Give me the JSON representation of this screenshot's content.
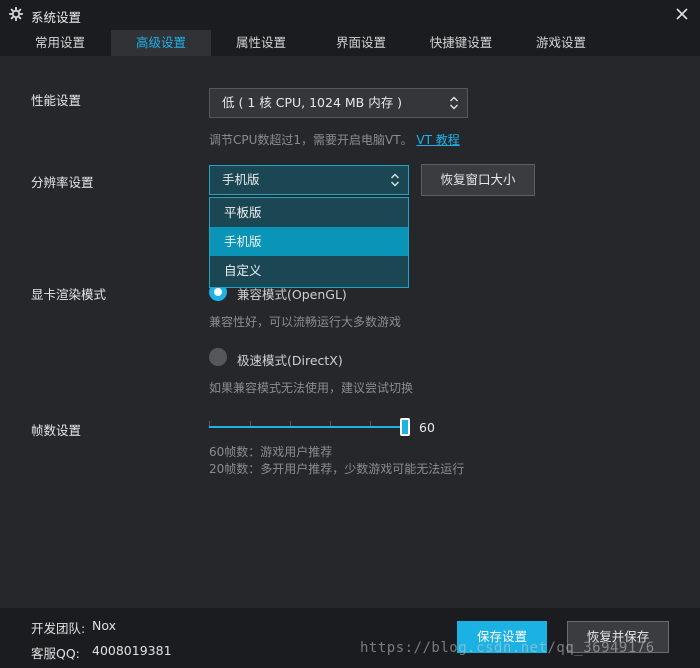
{
  "window": {
    "title": "系统设置"
  },
  "tabs": [
    {
      "label": "常用设置",
      "active": false
    },
    {
      "label": "高级设置",
      "active": true
    },
    {
      "label": "属性设置",
      "active": false
    },
    {
      "label": "界面设置",
      "active": false
    },
    {
      "label": "快捷键设置",
      "active": false
    },
    {
      "label": "游戏设置",
      "active": false
    }
  ],
  "performance": {
    "label": "性能设置",
    "selected": "低 ( 1 核 CPU, 1024 MB 内存 )",
    "hint": "调节CPU数超过1，需要开启电脑VT。",
    "link": "VT 教程"
  },
  "resolution": {
    "label": "分辨率设置",
    "selected": "手机版",
    "restore_button": "恢复窗口大小",
    "options": [
      {
        "label": "平板版",
        "selected": false
      },
      {
        "label": "手机版",
        "selected": true
      },
      {
        "label": "自定义",
        "selected": false
      }
    ]
  },
  "render": {
    "label": "显卡渲染模式",
    "options": [
      {
        "label": "兼容模式(OpenGL)",
        "hint": "兼容性好，可以流畅运行大多数游戏",
        "checked": true
      },
      {
        "label": "极速模式(DirectX)",
        "hint": "如果兼容模式无法使用，建议尝试切换",
        "checked": false
      }
    ]
  },
  "fps": {
    "label": "帧数设置",
    "value": 60,
    "value_text": "60",
    "min": 0,
    "max": 60,
    "hint1": "60帧数：游戏用户推荐",
    "hint2": "20帧数：多开用户推荐，少数游戏可能无法运行"
  },
  "footer": {
    "team_label": "开发团队:",
    "team_value": "Nox",
    "qq_label": "客服QQ:",
    "qq_value": "4008019381",
    "save_button": "保存设置",
    "restore_save_button": "恢复并保存",
    "watermark": "https://blog.csdn.net/qq_36949176"
  },
  "colors": {
    "accent": "#1fb2e8",
    "background": "#25272b",
    "titlebar": "#1b1c1f"
  }
}
